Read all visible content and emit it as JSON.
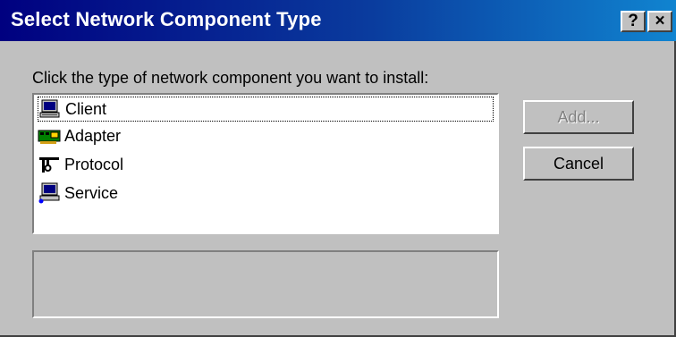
{
  "window": {
    "title": "Select Network Component Type",
    "help_label": "?",
    "close_label": "×"
  },
  "instruction": "Click the type of network component you want to install:",
  "components": [
    {
      "label": "Client",
      "icon": "client-computer-icon",
      "selected": true
    },
    {
      "label": "Adapter",
      "icon": "network-adapter-icon",
      "selected": false
    },
    {
      "label": "Protocol",
      "icon": "protocol-icon",
      "selected": false
    },
    {
      "label": "Service",
      "icon": "service-computer-icon",
      "selected": false
    }
  ],
  "description": "",
  "buttons": {
    "add_label": "Add...",
    "add_enabled": false,
    "cancel_label": "Cancel"
  },
  "colors": {
    "titlebar_start": "#000080",
    "titlebar_end": "#1084d0",
    "face": "#c0c0c0"
  }
}
